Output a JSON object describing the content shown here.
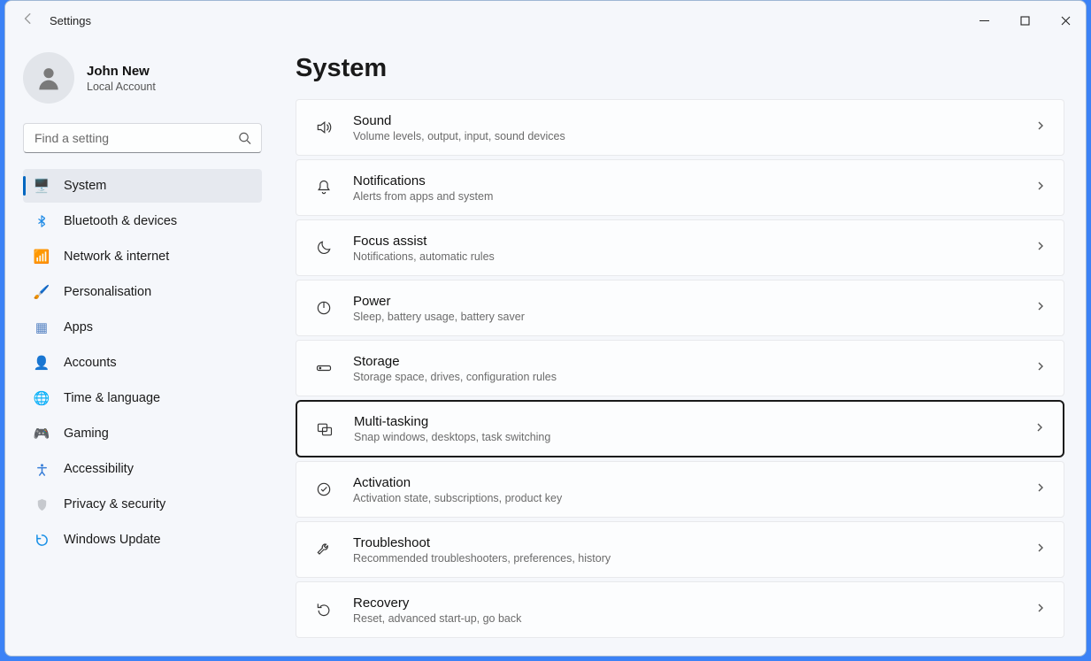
{
  "titlebar": {
    "title": "Settings"
  },
  "profile": {
    "name": "John New",
    "account": "Local Account"
  },
  "search": {
    "placeholder": "Find a setting"
  },
  "nav": [
    {
      "label": "System"
    },
    {
      "label": "Bluetooth & devices"
    },
    {
      "label": "Network & internet"
    },
    {
      "label": "Personalisation"
    },
    {
      "label": "Apps"
    },
    {
      "label": "Accounts"
    },
    {
      "label": "Time & language"
    },
    {
      "label": "Gaming"
    },
    {
      "label": "Accessibility"
    },
    {
      "label": "Privacy & security"
    },
    {
      "label": "Windows Update"
    }
  ],
  "page": {
    "title": "System"
  },
  "cards": [
    {
      "title": "Sound",
      "desc": "Volume levels, output, input, sound devices"
    },
    {
      "title": "Notifications",
      "desc": "Alerts from apps and system"
    },
    {
      "title": "Focus assist",
      "desc": "Notifications, automatic rules"
    },
    {
      "title": "Power",
      "desc": "Sleep, battery usage, battery saver"
    },
    {
      "title": "Storage",
      "desc": "Storage space, drives, configuration rules"
    },
    {
      "title": "Multi-tasking",
      "desc": "Snap windows, desktops, task switching"
    },
    {
      "title": "Activation",
      "desc": "Activation state, subscriptions, product key"
    },
    {
      "title": "Troubleshoot",
      "desc": "Recommended troubleshooters, preferences, history"
    },
    {
      "title": "Recovery",
      "desc": "Reset, advanced start-up, go back"
    }
  ]
}
